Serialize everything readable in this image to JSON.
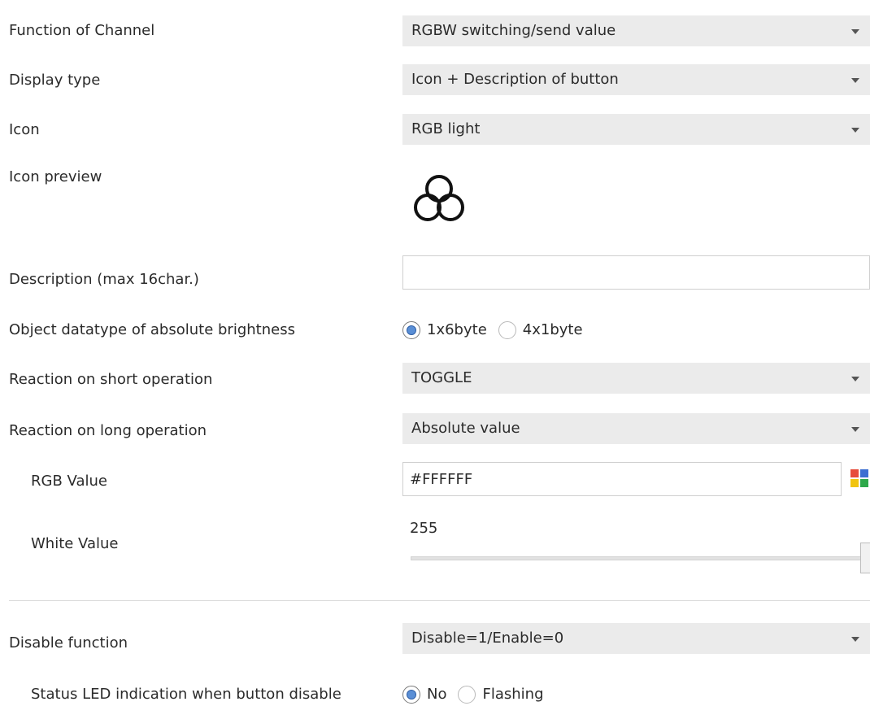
{
  "params": {
    "function_of_channel": {
      "label": "Function of Channel",
      "value": "RGBW switching/send value"
    },
    "display_type": {
      "label": "Display type",
      "value": "Icon + Description of button"
    },
    "icon": {
      "label": "Icon",
      "value": "RGB light"
    },
    "icon_preview": {
      "label": "Icon preview",
      "icon": "rgb-circles-icon"
    },
    "description": {
      "label": "Description (max 16char.)",
      "value": "",
      "placeholder": ""
    },
    "object_datatype": {
      "label": "Object datatype of absolute brightness",
      "options": [
        "1x6byte",
        "4x1byte"
      ],
      "selected": "1x6byte"
    },
    "short_operation": {
      "label": "Reaction on short operation",
      "value": "TOGGLE"
    },
    "long_operation": {
      "label": "Reaction on long operation",
      "value": "Absolute value"
    },
    "rgb_value": {
      "label": "RGB Value",
      "value": "#FFFFFF",
      "picker_icon": "color-palette-icon"
    },
    "white_value": {
      "label": "White Value",
      "value": "255",
      "max": 255
    },
    "disable_function": {
      "label": "Disable function",
      "value": "Disable=1/Enable=0"
    },
    "status_led": {
      "label": "Status LED indication when button disable",
      "options": [
        "No",
        "Flashing"
      ],
      "selected": "No"
    }
  },
  "colors": {
    "dropdown_bg": "#ebebeb",
    "radio_selected": "#5a8fd6",
    "palette": [
      "#e74c3c",
      "#3d6fd1",
      "#f1c40f",
      "#2ea84a"
    ]
  }
}
